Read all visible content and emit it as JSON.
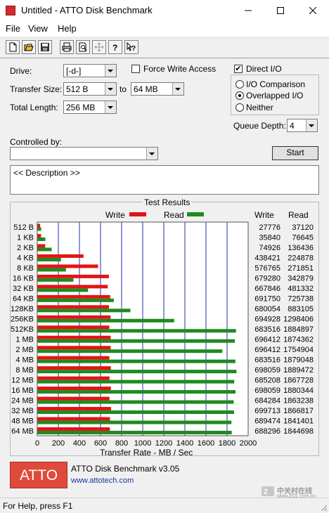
{
  "window": {
    "title": "Untitled - ATTO Disk Benchmark"
  },
  "menu": [
    "File",
    "View",
    "Help"
  ],
  "toolbar_icons": [
    "new-document-icon",
    "open-folder-icon",
    "save-icon",
    "print-icon",
    "print-preview-icon",
    "move-icon",
    "help-icon",
    "context-help-icon"
  ],
  "settings": {
    "drive_label": "Drive:",
    "drive_value": "[-d-]",
    "transfer_size_label": "Transfer Size:",
    "transfer_from": "512 B",
    "to_label": "to",
    "transfer_to": "64 MB",
    "total_length_label": "Total Length:",
    "total_length_value": "256 MB",
    "force_write_label": "Force Write Access",
    "force_write_checked": false,
    "direct_io_label": "Direct I/O",
    "direct_io_checked": true,
    "io_comparison_label": "I/O Comparison",
    "overlapped_io_label": "Overlapped I/O",
    "neither_label": "Neither",
    "selected_io_mode": "Overlapped I/O",
    "queue_depth_label": "Queue Depth:",
    "queue_depth_value": "4",
    "controlled_by_label": "Controlled by:",
    "controlled_by_value": "",
    "start_label": "Start",
    "description_text": "<< Description >>"
  },
  "results": {
    "title": "Test Results",
    "legend_write": "Write",
    "legend_read": "Read",
    "col_write": "Write",
    "col_read": "Read",
    "xlabel": "Transfer Rate - MB / Sec"
  },
  "chart_data": {
    "type": "bar",
    "orientation": "horizontal",
    "title": "Test Results",
    "xlabel": "Transfer Rate - MB / Sec",
    "xlim": [
      0,
      2000
    ],
    "xticks": [
      0,
      200,
      400,
      600,
      800,
      1000,
      1200,
      1400,
      1600,
      1800,
      2000
    ],
    "grid": true,
    "legend_placement": "top",
    "colors": {
      "write": "#e31414",
      "read": "#1f8a1f"
    },
    "categories": [
      "512 B",
      "1 KB",
      "2 KB",
      "4 KB",
      "8 KB",
      "16 KB",
      "32 KB",
      "64 KB",
      "128KB",
      "256KB",
      "512KB",
      "1 MB",
      "2 MB",
      "4 MB",
      "8 MB",
      "12 MB",
      "16 MB",
      "24 MB",
      "32 MB",
      "48 MB",
      "64 MB"
    ],
    "series": [
      {
        "name": "Write",
        "values": [
          27.776,
          35.84,
          74.926,
          438.421,
          576.765,
          679.28,
          667.846,
          691.75,
          680.054,
          694.928,
          683.516,
          696.412,
          696.412,
          683.516,
          698.059,
          685.208,
          698.059,
          684.284,
          699.713,
          689.474,
          688.296
        ],
        "labels": [
          "27776",
          "35840",
          "74926",
          "438421",
          "576765",
          "679280",
          "667846",
          "691750",
          "680054",
          "694928",
          "683516",
          "696412",
          "696412",
          "683516",
          "698059",
          "685208",
          "698059",
          "684284",
          "699713",
          "689474",
          "688296"
        ]
      },
      {
        "name": "Read",
        "values": [
          37.12,
          76.645,
          136.436,
          224.878,
          271.851,
          342.879,
          481.332,
          725.738,
          883.105,
          1298.406,
          1884.897,
          1874.362,
          1754.904,
          1879.048,
          1889.472,
          1867.728,
          1880.344,
          1863.238,
          1866.817,
          1841.401,
          1844.698
        ],
        "labels": [
          "37120",
          "76645",
          "136436",
          "224878",
          "271851",
          "342879",
          "481332",
          "725738",
          "883105",
          "1298406",
          "1884897",
          "1874362",
          "1754904",
          "1879048",
          "1889472",
          "1867728",
          "1880344",
          "1863238",
          "1866817",
          "1841401",
          "1844698"
        ]
      }
    ]
  },
  "footer": {
    "logo_text": "ATTO",
    "product_title": "ATTO Disk Benchmark v3.05",
    "url": "www.attotech.com",
    "watermark_text": "中关村在线",
    "watermark_url": "www.ZOL.com.cn"
  },
  "status": {
    "text": "For Help, press F1"
  }
}
